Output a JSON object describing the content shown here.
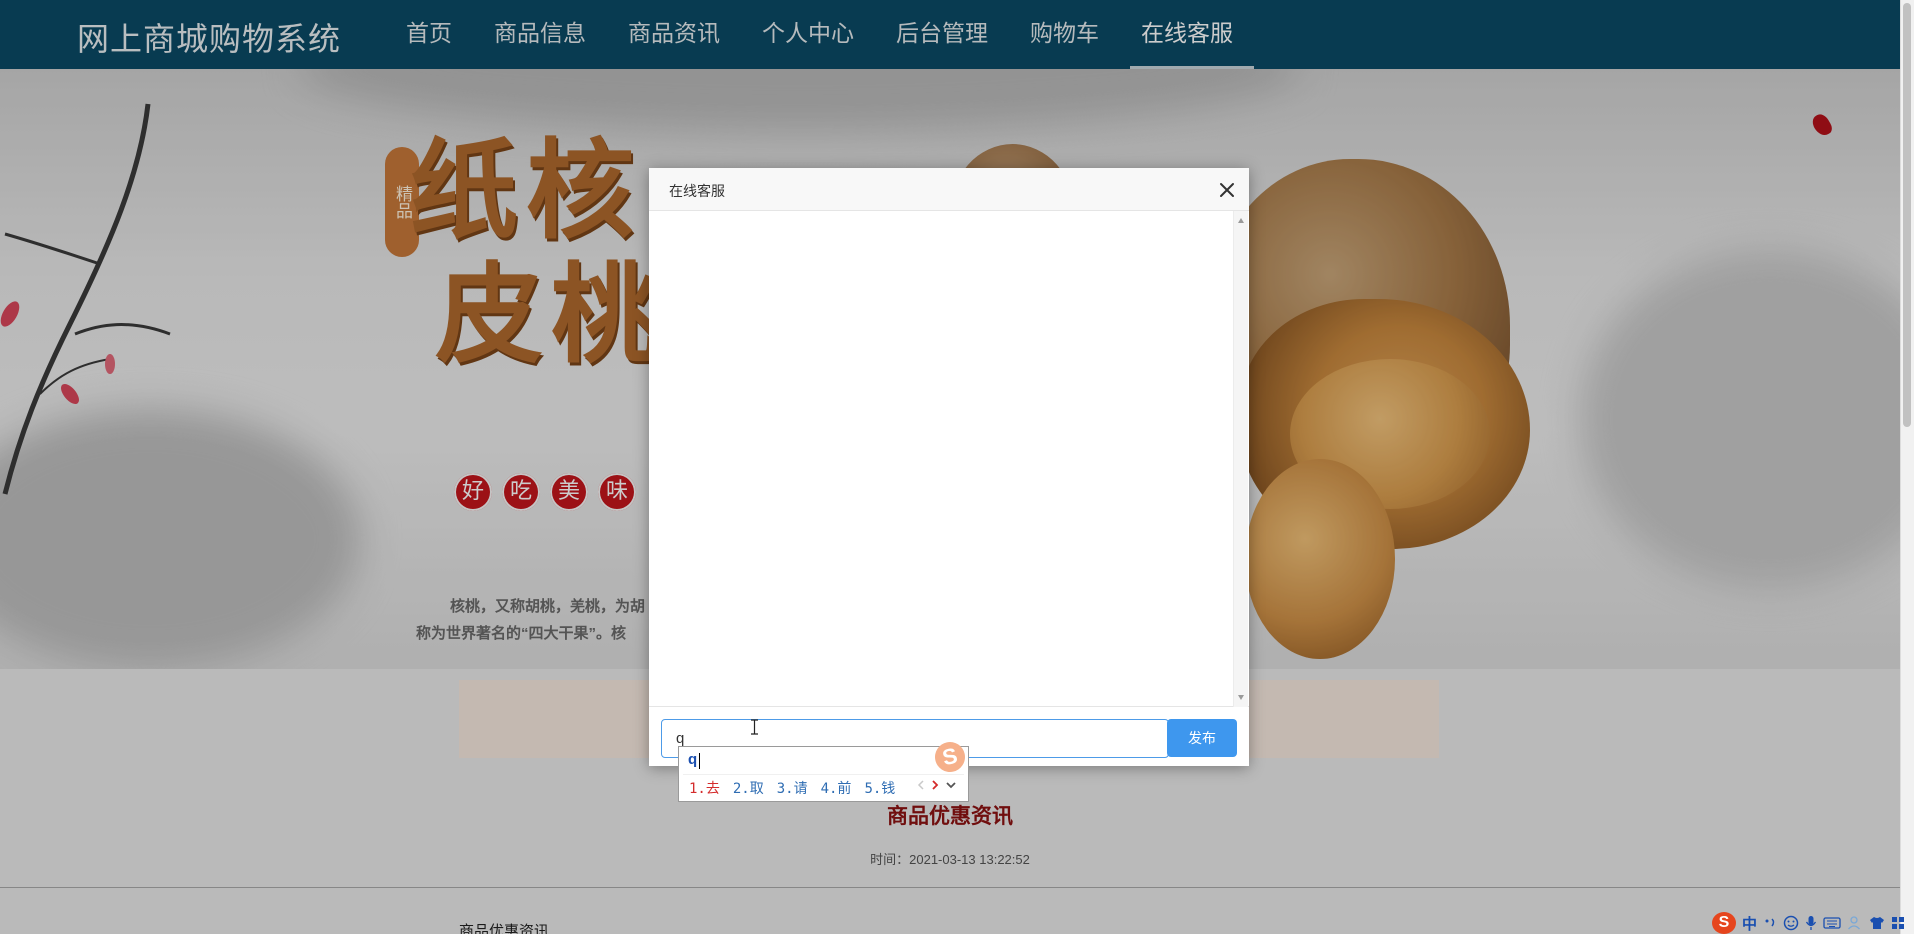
{
  "navbar": {
    "brand": "网上商城购物系统",
    "items": [
      {
        "label": "首页"
      },
      {
        "label": "商品信息"
      },
      {
        "label": "商品资讯"
      },
      {
        "label": "个人中心"
      },
      {
        "label": "后台管理"
      },
      {
        "label": "购物车"
      },
      {
        "label": "在线客服",
        "active": true
      }
    ]
  },
  "banner": {
    "title_line1": "纸核",
    "title_line2": "皮桃",
    "badge_text": "精品",
    "circles": [
      "好",
      "吃",
      "美",
      "味"
    ],
    "desc_line1": "核桃，又称胡桃，羌桃，为胡",
    "desc_line2": "称为世界著名的“四大干果”。核"
  },
  "news": {
    "title": "商品优惠资讯",
    "time": "时间：2021-03-13 13:22:52",
    "below_heading": "商品优惠资讯"
  },
  "modal": {
    "title": "在线客服",
    "close_icon": "close-icon",
    "input_value": "q",
    "send_label": "发布"
  },
  "ime": {
    "pinyin": "q",
    "candidates": [
      "1.去",
      "2.取",
      "3.请",
      "4.前",
      "5.钱"
    ],
    "logo": "S"
  },
  "tray": {
    "logo": "S",
    "lang": "中",
    "icons": [
      "punctuation-icon",
      "emoji-icon",
      "microphone-icon",
      "keyboard-icon",
      "user-icon",
      "shirt-icon",
      "grid-icon"
    ]
  },
  "colors": {
    "navbar_bg": "#0b4a66",
    "accent_blue": "#3e97ee",
    "news_red": "#8c1212",
    "circle_red": "#c4161c"
  }
}
